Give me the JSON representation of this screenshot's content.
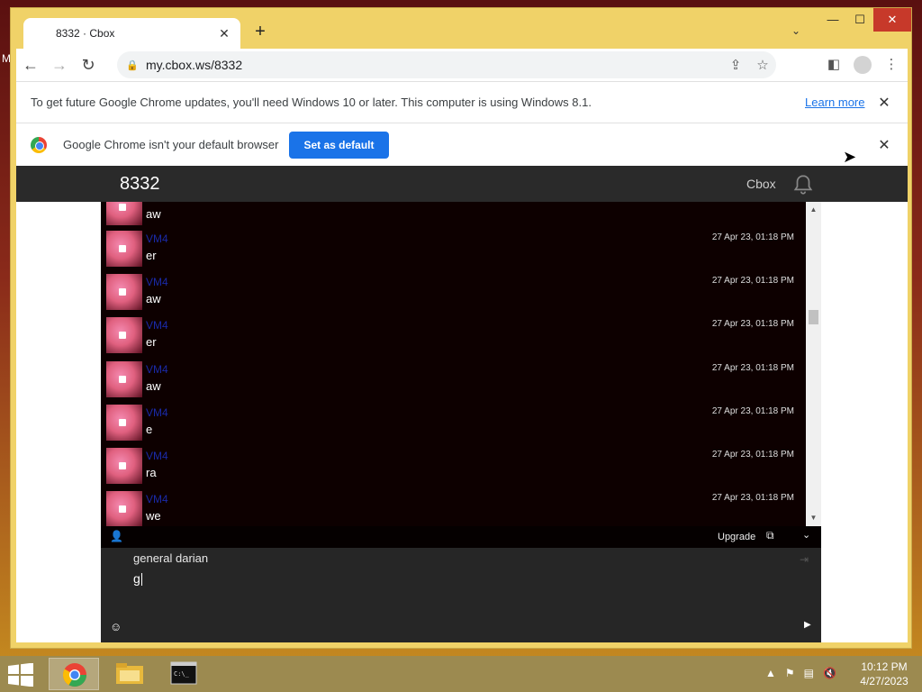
{
  "desktop": {
    "label": "M"
  },
  "window": {
    "tab_title": "8332 · Cbox",
    "new_tab": "+",
    "tab_search": "⌄",
    "controls": {
      "minimize": "—",
      "maximize": "☐",
      "close": "✕"
    }
  },
  "toolbar": {
    "back": "←",
    "forward": "→",
    "reload": "↻",
    "url": "my.cbox.ws/8332",
    "share": "⇪",
    "star": "☆",
    "sidepanel": "◧",
    "menu": "⋮"
  },
  "infobar_update": {
    "text": "To get future Google Chrome updates, you'll need Windows 10 or later. This computer is using Windows 8.1.",
    "link": "Learn more",
    "close": "✕"
  },
  "infobar_default": {
    "text": "Google Chrome isn't your default browser",
    "button": "Set as default",
    "close": "✕"
  },
  "cbox": {
    "title": "8332",
    "brand": "Cbox",
    "messages": [
      {
        "name": "",
        "text": "aw",
        "time": ""
      },
      {
        "name": "VM4",
        "text": "er",
        "time": "27 Apr 23, 01:18 PM"
      },
      {
        "name": "VM4",
        "text": "aw",
        "time": "27 Apr 23, 01:18 PM"
      },
      {
        "name": "VM4",
        "text": "er",
        "time": "27 Apr 23, 01:18 PM"
      },
      {
        "name": "VM4",
        "text": "aw",
        "time": "27 Apr 23, 01:18 PM"
      },
      {
        "name": "VM4",
        "text": "e",
        "time": "27 Apr 23, 01:18 PM"
      },
      {
        "name": "VM4",
        "text": "ra",
        "time": "27 Apr 23, 01:18 PM"
      },
      {
        "name": "VM4",
        "text": "we",
        "time": "27 Apr 23, 01:18 PM"
      }
    ],
    "upgrade": "Upgrade",
    "compose_name": "general darian",
    "compose_text": "g"
  },
  "taskbar": {
    "time": "10:12 PM",
    "date": "4/27/2023"
  }
}
